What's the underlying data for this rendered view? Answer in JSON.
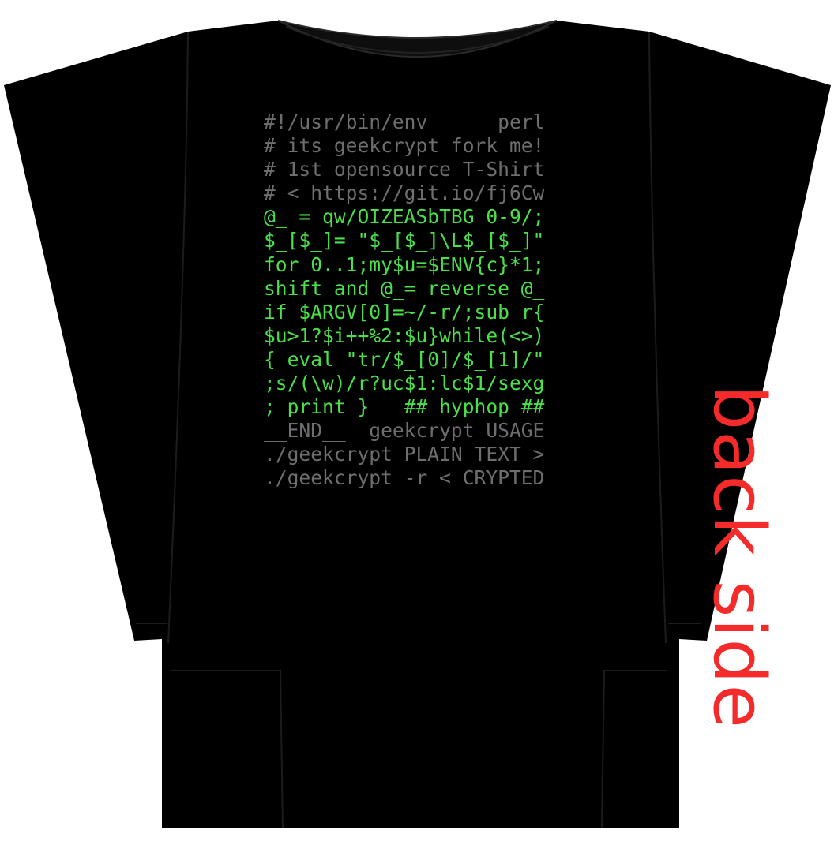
{
  "colors": {
    "shirt": "#000000",
    "comment_text": "#6e6e6e",
    "code_text": "#4ae04a",
    "label": "#f52a2a"
  },
  "code_lines": [
    {
      "text": "#!/usr/bin/env      perl",
      "tone": "gray"
    },
    {
      "text": "# its geekcrypt fork me!",
      "tone": "gray"
    },
    {
      "text": "# 1st opensource T-Shirt",
      "tone": "gray"
    },
    {
      "text": "# < https://git.io/fj6Cw",
      "tone": "gray"
    },
    {
      "text": "@_ = qw/OIZEASbTBG 0-9/;",
      "tone": "green"
    },
    {
      "text": "$_[$_]= \"$_[$_]\\L$_[$_]\"",
      "tone": "green"
    },
    {
      "text": "for 0..1;my$u=$ENV{c}*1;",
      "tone": "green"
    },
    {
      "text": "shift and @_= reverse @_",
      "tone": "green"
    },
    {
      "text": "if $ARGV[0]=~/-r/;sub r{",
      "tone": "green"
    },
    {
      "text": "$u>1?$i++%2:$u}while(<>)",
      "tone": "green"
    },
    {
      "text": "{ eval \"tr/$_[0]/$_[1]/\"",
      "tone": "green"
    },
    {
      "text": ";s/(\\w)/r?uc$1:lc$1/sexg",
      "tone": "green"
    },
    {
      "text": "; print }   ## hyphop ##",
      "tone": "green"
    },
    {
      "text": "__END__  geekcrypt USAGE",
      "tone": "gray"
    },
    {
      "text": "./geekcrypt PLAIN_TEXT >",
      "tone": "gray"
    },
    {
      "text": "./geekcrypt -r < CRYPTED",
      "tone": "gray"
    }
  ],
  "side_label": "back side"
}
